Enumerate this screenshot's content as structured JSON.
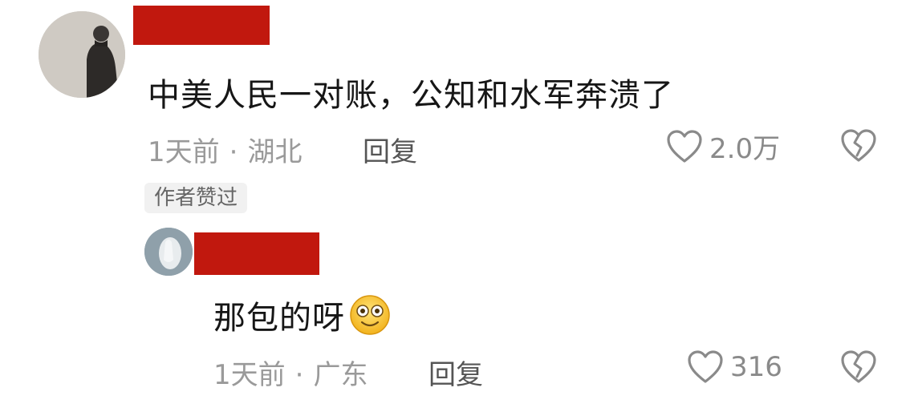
{
  "comment": {
    "text": "中美人民一对账，公知和水军奔溃了",
    "time": "1天前",
    "separator": "·",
    "location": "湖北",
    "reply_label": "回复",
    "like_count": "2.0万",
    "author_liked_badge": "作者赞过"
  },
  "reply": {
    "text": "那包的呀",
    "emoji": "smiling-face-with-wide-eyes",
    "time": "1天前",
    "separator": "·",
    "location": "广东",
    "reply_label": "回复",
    "like_count": "316"
  },
  "colors": {
    "redaction": "#c1180e",
    "meta_text": "#9a9a9a",
    "icon_stroke": "#8a8a8a"
  }
}
